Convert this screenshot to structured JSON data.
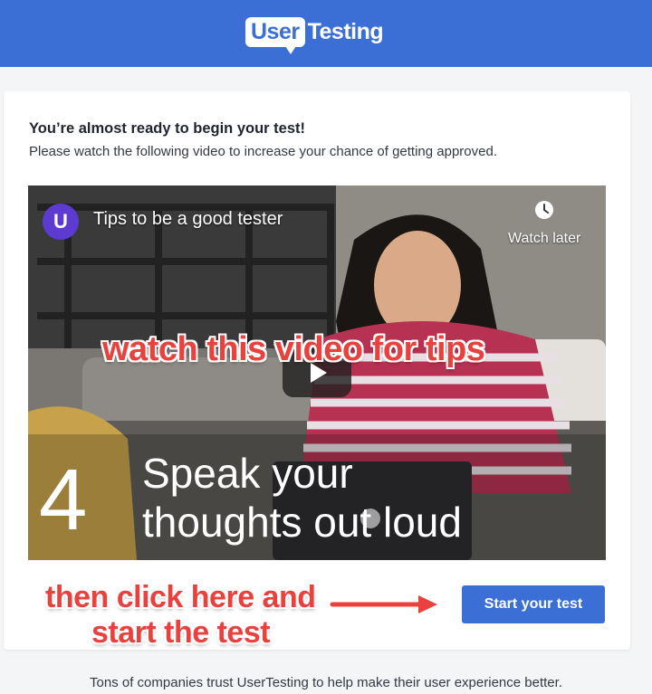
{
  "header": {
    "logo_user": "User",
    "logo_testing": "Testing",
    "background_color": "#3b6fd6"
  },
  "card": {
    "heading": "You’re almost ready to begin your test!",
    "subtext": "Please watch the following video to increase your chance of getting approved."
  },
  "video": {
    "channel_logo_letter": "U",
    "title": "Tips to be a good tester",
    "watch_later_label": "Watch later",
    "watch_later_icon": "clock-icon",
    "play_icon": "play-icon",
    "overlay_number": "4",
    "overlay_line1": "Speak your",
    "overlay_line2": "thoughts out loud"
  },
  "annotations": {
    "video_tip": "watch this video for tips",
    "click_line1": "then click here and",
    "click_line2": "start the test",
    "color": "#e8413e"
  },
  "actions": {
    "start_label": "Start your test"
  },
  "footer": {
    "text": "Tons of companies trust UserTesting to help make their user experience better."
  }
}
